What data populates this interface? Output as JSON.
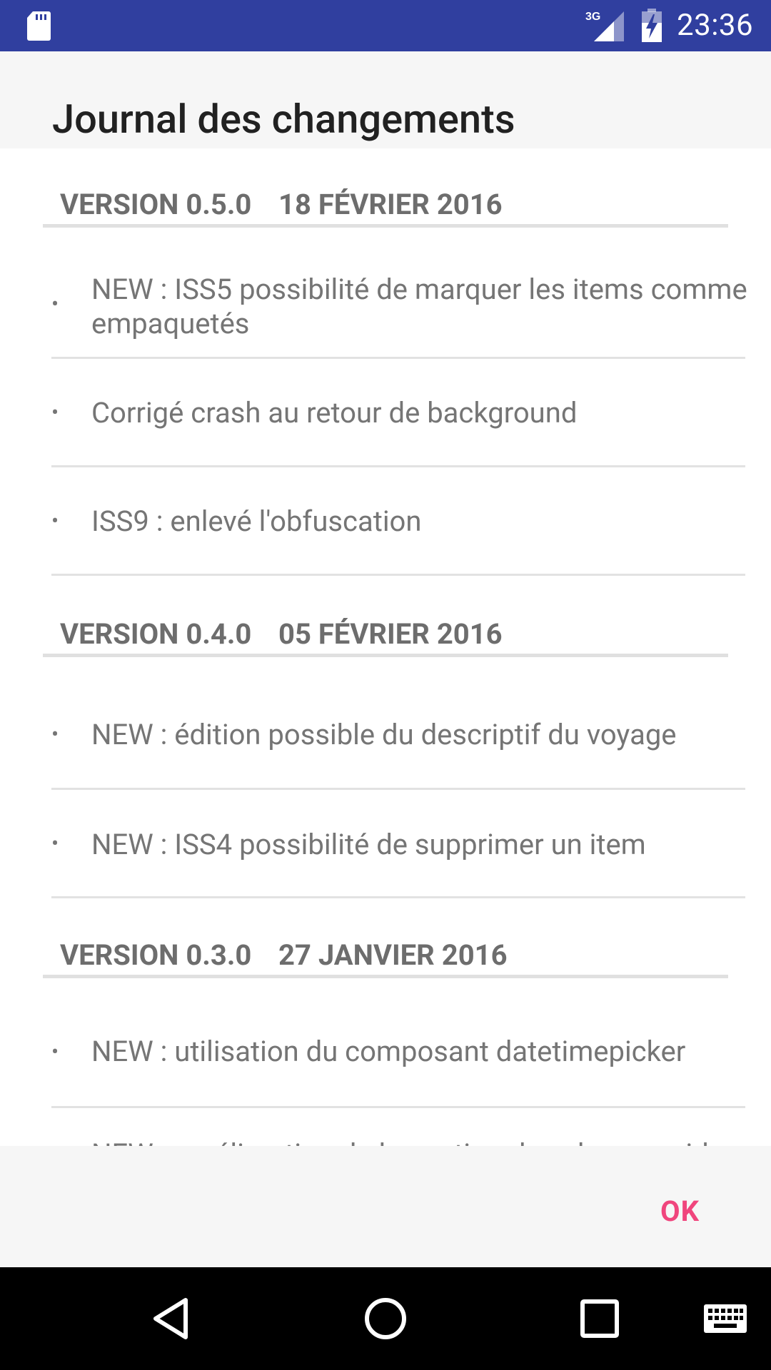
{
  "status_bar": {
    "network": "3G",
    "time": "23:36",
    "icons": [
      "sd-card-icon",
      "signal-icon",
      "battery-charging-icon"
    ]
  },
  "dialog": {
    "title": "Journal des changements",
    "ok_label": "OK",
    "accent_color": "#f0457d"
  },
  "versions": [
    {
      "version": "VERSION 0.5.0",
      "date": "18 FÉVRIER 2016",
      "entries": [
        "NEW : ISS5 possibilité de marquer les items comme empaquetés",
        "Corrigé crash au retour de background",
        "ISS9 : enlevé l'obfuscation"
      ]
    },
    {
      "version": "VERSION 0.4.0",
      "date": "05 FÉVRIER 2016",
      "entries": [
        "NEW : édition possible du descriptif du voyage",
        "NEW : ISS4 possibilité de supprimer un item"
      ]
    },
    {
      "version": "VERSION 0.3.0",
      "date": "27 JANVIER 2016",
      "entries": [
        "NEW : utilisation du composant datetimepicker",
        "NEW : amélioration de la gestion des champs vide"
      ]
    }
  ],
  "bullet": "•",
  "nav_bar": {
    "icons": [
      "back-icon",
      "home-icon",
      "recents-icon",
      "keyboard-icon"
    ]
  }
}
